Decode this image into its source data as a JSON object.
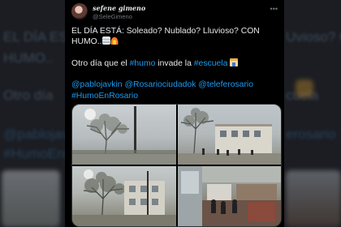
{
  "tweet": {
    "display_name": "sefene gimeno",
    "handle": "@SeleGimeno",
    "line1": "EL DÍA ESTÁ: Soleado? Nublado? Lluvioso? CON HUMO..",
    "line2_before": "Otro día que el ",
    "hashtag_humo": "#humo",
    "line2_middle": " invade la ",
    "hashtag_escuela": "#escuela",
    "mentions": [
      "@pablojavkin",
      "@Rosariociudadok",
      "@teleferosario"
    ],
    "hashtag_humo_en_rosario": "#HumoEnRosario",
    "emojis": [
      "fog-icon",
      "fire-icon",
      "school-icon"
    ]
  },
  "photos": [
    {
      "name": "photo-tree-smoky-sky"
    },
    {
      "name": "photo-schoolyard-students"
    },
    {
      "name": "photo-tree-buildings-haze"
    },
    {
      "name": "photo-classroom-hallway"
    }
  ],
  "backdrop": {
    "text_a": "EL DÍA ESTÁ: Sole",
    "text_b": "Uvioso? CON",
    "text_c": "HUMO..",
    "text_d": "Otro día",
    "text_e": "cuela",
    "text_f": "@pablojavk",
    "text_g": "#HumoEnRos",
    "text_h": "erosario"
  },
  "colors": {
    "background": "#000000",
    "text": "#e7e9ea",
    "secondary": "#71767b",
    "link": "#1d9bf0"
  }
}
